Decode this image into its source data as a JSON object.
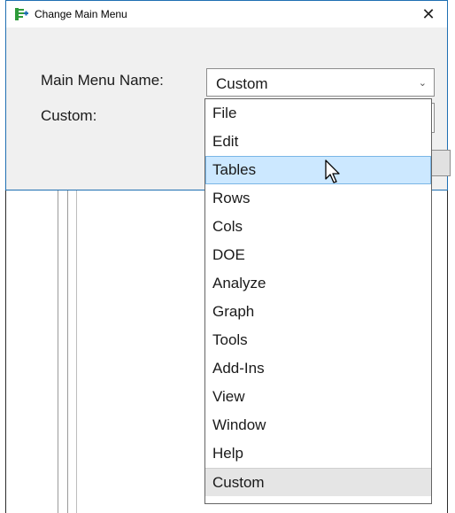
{
  "window": {
    "title": "Change Main Menu",
    "close_glyph": "✕"
  },
  "form": {
    "menu_name_label": "Main Menu Name:",
    "custom_label": "Custom:",
    "selected_value": "Custom",
    "caret_glyph": "⌄"
  },
  "dropdown": {
    "options": [
      {
        "label": "File"
      },
      {
        "label": "Edit"
      },
      {
        "label": "Tables"
      },
      {
        "label": "Rows"
      },
      {
        "label": "Cols"
      },
      {
        "label": "DOE"
      },
      {
        "label": "Analyze"
      },
      {
        "label": "Graph"
      },
      {
        "label": "Tools"
      },
      {
        "label": "Add-Ins"
      },
      {
        "label": "View"
      },
      {
        "label": "Window"
      },
      {
        "label": "Help"
      },
      {
        "label": "Custom"
      }
    ],
    "hovered_label": "Tables",
    "selected_label": "Custom"
  },
  "colors": {
    "accent": "#1f6fb2",
    "hover": "#cce8ff",
    "icon_green": "#2e9b3a"
  }
}
